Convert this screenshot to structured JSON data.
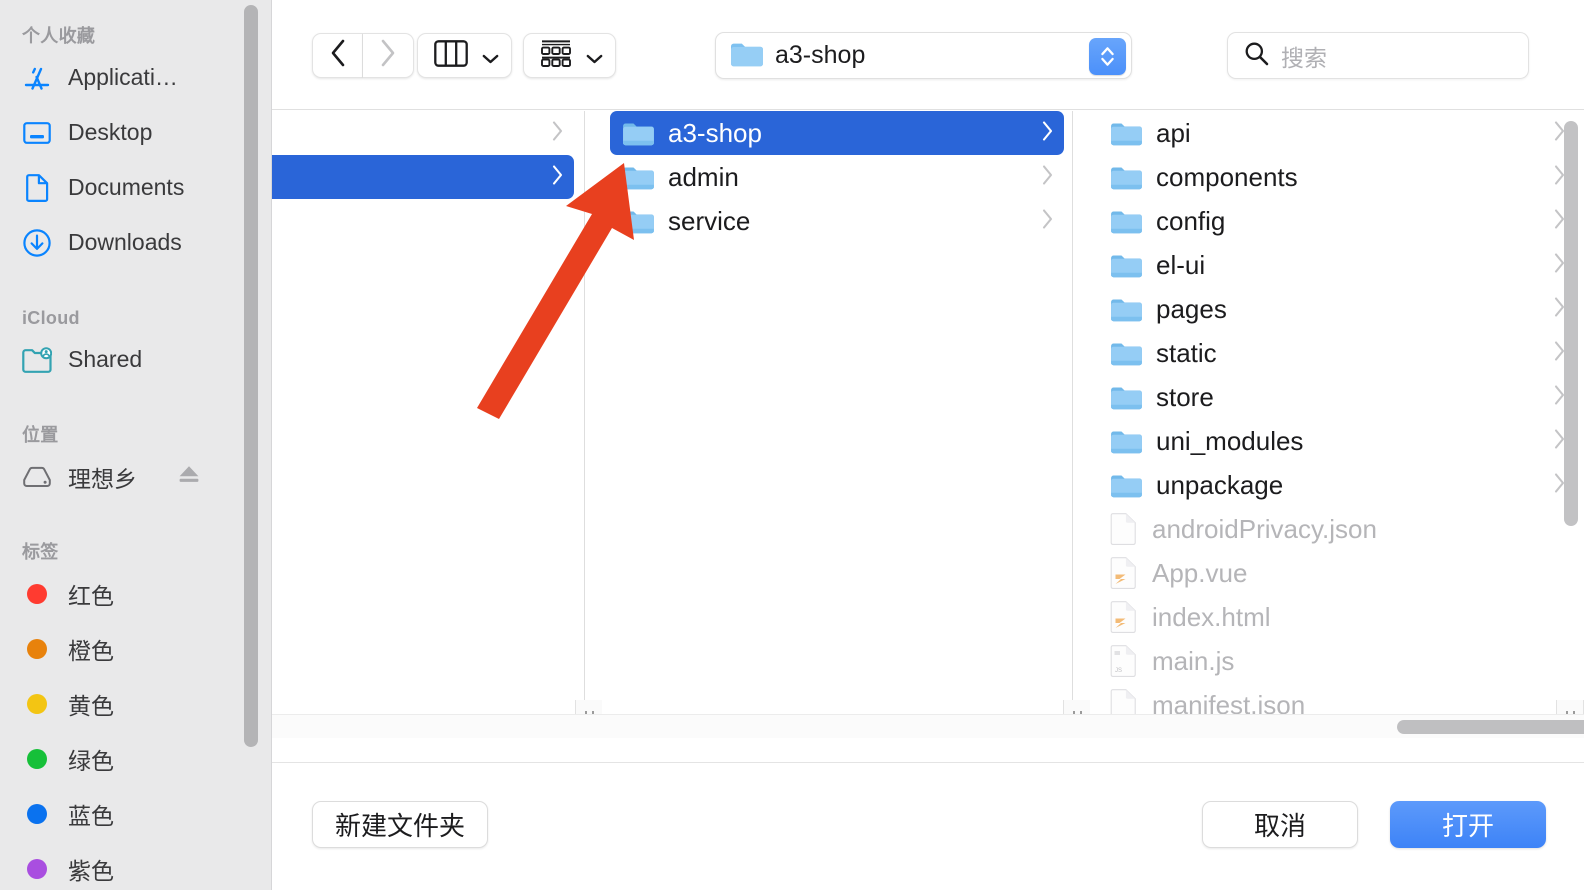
{
  "sidebar": {
    "sections": [
      {
        "title": "个人收藏",
        "items": [
          {
            "label": "Applicati…",
            "icon": "applications-icon"
          },
          {
            "label": "Desktop",
            "icon": "desktop-icon"
          },
          {
            "label": "Documents",
            "icon": "documents-icon"
          },
          {
            "label": "Downloads",
            "icon": "downloads-icon"
          }
        ]
      },
      {
        "title": "iCloud",
        "items": [
          {
            "label": "Shared",
            "icon": "shared-folder-icon"
          }
        ]
      },
      {
        "title": "位置",
        "items": [
          {
            "label": "理想乡",
            "icon": "external-drive-icon",
            "eject": true
          }
        ]
      },
      {
        "title": "标签",
        "items": [
          {
            "label": "红色",
            "icon": "tag-dot-icon",
            "color": "#ff3b30"
          },
          {
            "label": "橙色",
            "icon": "tag-dot-icon",
            "color": "#e8820c"
          },
          {
            "label": "黄色",
            "icon": "tag-dot-icon",
            "color": "#f3c513"
          },
          {
            "label": "绿色",
            "icon": "tag-dot-icon",
            "color": "#16c039"
          },
          {
            "label": "蓝色",
            "icon": "tag-dot-icon",
            "color": "#0a72ef"
          },
          {
            "label": "紫色",
            "icon": "tag-dot-icon",
            "color": "#a94ee0"
          }
        ]
      }
    ]
  },
  "toolbar": {
    "back_icon": "chevron-left-icon",
    "forward_icon": "chevron-right-icon",
    "view_mode_icon": "column-view-icon",
    "group_by_icon": "group-by-icon",
    "path_label": "a3-shop",
    "path_icon": "folder-icon",
    "stepper_icon": "up-down-stepper-icon",
    "search_icon": "search-icon",
    "search_placeholder": "搜索",
    "search_value": ""
  },
  "browser": {
    "columns": [
      {
        "name": "column-1",
        "rows": [
          {
            "label": "",
            "kind": "folder",
            "selected": false,
            "chevron": true
          },
          {
            "label": "",
            "kind": "folder",
            "selected": true,
            "chevron": true
          }
        ]
      },
      {
        "name": "column-2",
        "rows": [
          {
            "label": "a3-shop",
            "kind": "folder",
            "selected": true,
            "chevron": true
          },
          {
            "label": "admin",
            "kind": "folder",
            "selected": false,
            "chevron": true
          },
          {
            "label": "service",
            "kind": "folder",
            "selected": false,
            "chevron": true
          }
        ]
      },
      {
        "name": "column-3",
        "rows": [
          {
            "label": "api",
            "kind": "folder",
            "selected": false,
            "chevron": true
          },
          {
            "label": "components",
            "kind": "folder",
            "selected": false,
            "chevron": true
          },
          {
            "label": "config",
            "kind": "folder",
            "selected": false,
            "chevron": true
          },
          {
            "label": "el-ui",
            "kind": "folder",
            "selected": false,
            "chevron": true
          },
          {
            "label": "pages",
            "kind": "folder",
            "selected": false,
            "chevron": true
          },
          {
            "label": "static",
            "kind": "folder",
            "selected": false,
            "chevron": true
          },
          {
            "label": "store",
            "kind": "folder",
            "selected": false,
            "chevron": true
          },
          {
            "label": "uni_modules",
            "kind": "folder",
            "selected": false,
            "chevron": true
          },
          {
            "label": "unpackage",
            "kind": "folder",
            "selected": false,
            "chevron": true
          },
          {
            "label": "androidPrivacy.json",
            "kind": "doc",
            "selected": false,
            "chevron": false,
            "disabled": true
          },
          {
            "label": "App.vue",
            "kind": "vue",
            "selected": false,
            "chevron": false,
            "disabled": true
          },
          {
            "label": "index.html",
            "kind": "vue",
            "selected": false,
            "chevron": false,
            "disabled": true
          },
          {
            "label": "main.js",
            "kind": "js",
            "selected": false,
            "chevron": false,
            "disabled": true
          },
          {
            "label": "manifest.json",
            "kind": "doc",
            "selected": false,
            "chevron": false,
            "disabled": true
          }
        ]
      }
    ]
  },
  "footer": {
    "new_folder_label": "新建文件夹",
    "cancel_label": "取消",
    "open_label": "打开"
  },
  "annotation": {
    "arrow_color": "#e8401f",
    "arrow_name": "red-pointer-arrow"
  },
  "colors": {
    "selection_blue": "#2a65d8",
    "accent_blue": "#3d83f7",
    "sidebar_bg": "#e9e9ea"
  }
}
